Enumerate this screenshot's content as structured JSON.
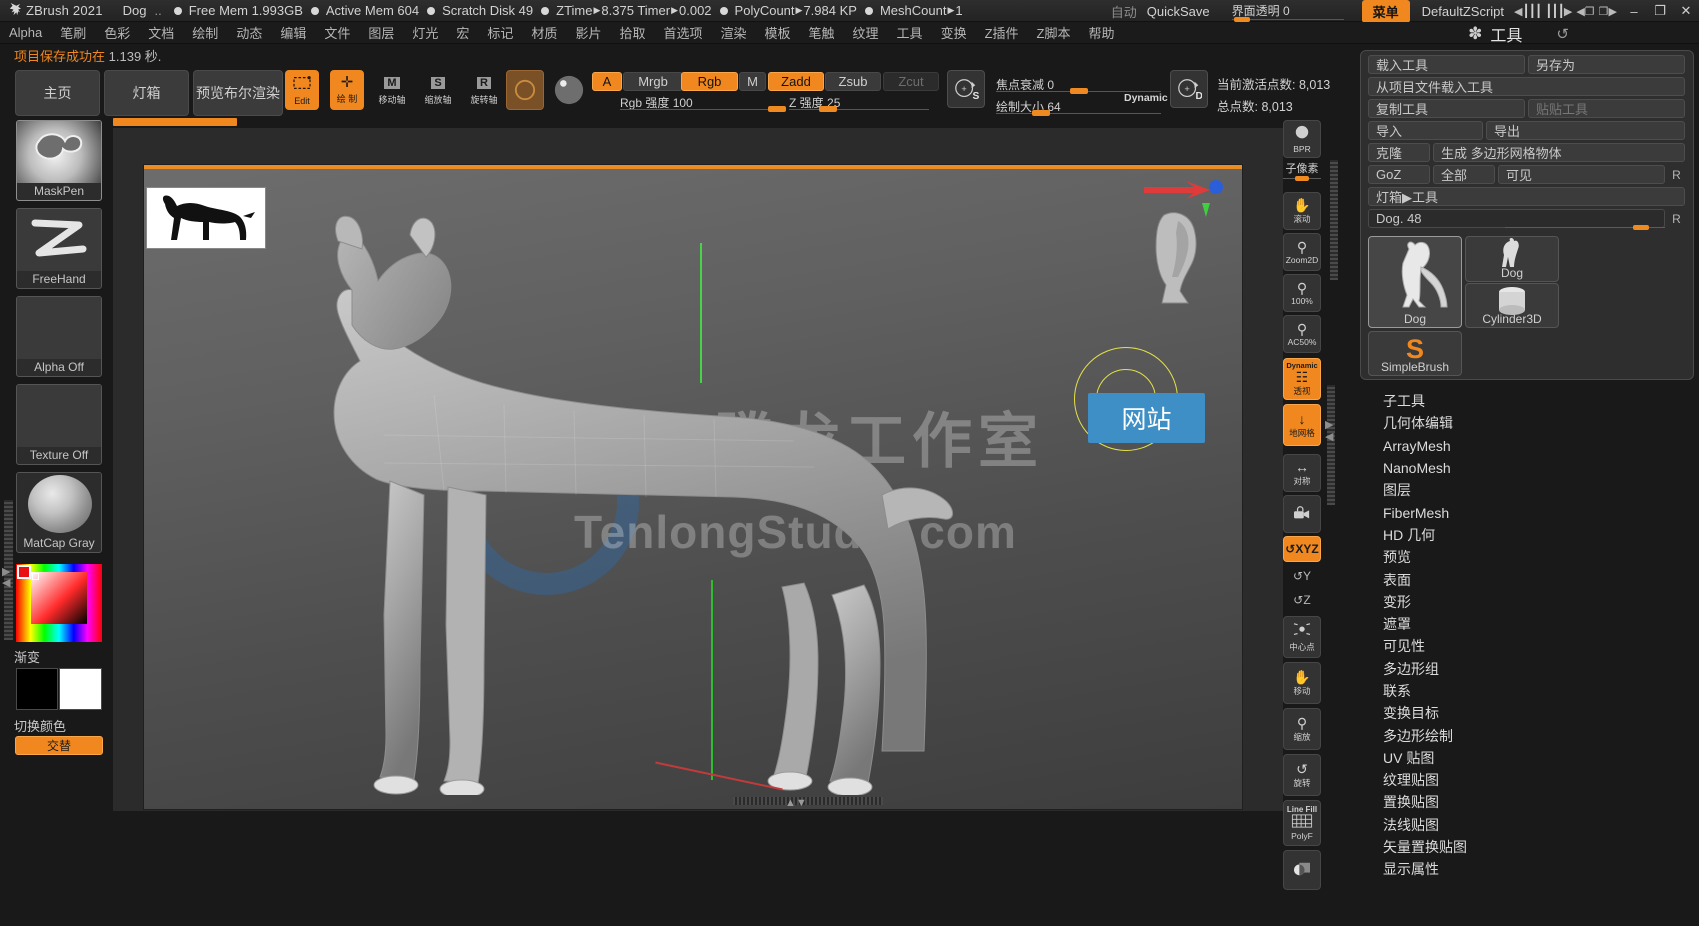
{
  "titlebar": {
    "logo_icon": "zbrush-logo-icon",
    "app_name": "ZBrush 2021",
    "document_name": "Dog",
    "dots": "..",
    "stats": [
      {
        "label": "Free Mem 1.993GB"
      },
      {
        "label": "Active Mem 604"
      },
      {
        "label": "Scratch Disk 49"
      },
      {
        "label": "ZTime",
        "arrow": "▶",
        "value": "8.375 Timer",
        "arrow2": "▶",
        "value2": "0.002"
      },
      {
        "label": "PolyCount",
        "arrow": "▶",
        "value": "7.984 KP"
      },
      {
        "label": "MeshCount",
        "arrow": "▶",
        "value": "1"
      }
    ],
    "auto_label": "自动",
    "quicksave_label": "QuickSave",
    "ui_transparency_label": "界面透明",
    "ui_transparency_value": "0",
    "menu_button": "菜单",
    "zscript_label": "DefaultZScript",
    "minimize": "–",
    "maximize": "❐",
    "close": "✕"
  },
  "menubar": {
    "items": [
      "Alpha",
      "笔刷",
      "色彩",
      "文档",
      "绘制",
      "动态",
      "编辑",
      "文件",
      "图层",
      "灯光",
      "宏",
      "标记",
      "材质",
      "影片",
      "拾取",
      "首选项",
      "渲染",
      "模板",
      "笔触",
      "纹理",
      "工具",
      "变换",
      "Z插件",
      "Z脚本",
      "帮助"
    ],
    "tool_title_icon": "brush-icon",
    "tool_title": "工具",
    "refresh_icon": "↺"
  },
  "status": {
    "message_orange": "项目保存成功在",
    "message_gray": "1.139 秒."
  },
  "toolbar": {
    "home_button": "主页",
    "lightbox_button": "灯箱",
    "preview_bool_render_button": "预览布尔渲染",
    "edit_button": "Edit",
    "draw_button": "绘 制",
    "move_button": "移动轴",
    "scale_button": "缩放轴",
    "rotate_button": "旋转轴",
    "move_badge": "M",
    "scale_badge": "S",
    "rotate_badge": "R",
    "material_icon": "material-sphere-icon",
    "chips": [
      {
        "name": "A",
        "label": "A",
        "state": "on"
      },
      {
        "name": "Mrgb",
        "label": "Mrgb",
        "state": "off"
      },
      {
        "name": "Rgb",
        "label": "Rgb",
        "state": "on"
      },
      {
        "name": "M",
        "label": "M",
        "state": "off"
      },
      {
        "name": "Zadd",
        "label": "Zadd",
        "state": "on"
      },
      {
        "name": "Zsub",
        "label": "Zsub",
        "state": "off"
      },
      {
        "name": "Zcut",
        "label": "Zcut",
        "state": "dim"
      }
    ],
    "rgb_intensity_label": "Rgb 强度",
    "rgb_intensity_value": "100",
    "z_intensity_label": "Z 强度",
    "z_intensity_value": "25",
    "focal_shift_label": "焦点衰减",
    "focal_shift_value": "0",
    "draw_size_label": "绘制大小",
    "draw_size_value": "64",
    "dynamic_label": "Dynamic",
    "s_button_icon": "stroke-s-icon",
    "d_button_icon": "dynamic-d-icon",
    "active_points_label": "当前激活点数: 8,013",
    "total_points_label": "总点数: 8,013"
  },
  "leftbar": {
    "swatches": [
      {
        "name": "maskpen",
        "label": "MaskPen",
        "selected": true
      },
      {
        "name": "freehand",
        "label": "FreeHand",
        "selected": false
      },
      {
        "name": "alpha",
        "label": "Alpha Off",
        "selected": false
      },
      {
        "name": "texture",
        "label": "Texture Off",
        "selected": false
      },
      {
        "name": "matcap",
        "label": "MatCap Gray",
        "selected": false
      }
    ],
    "gradient_label": "渐变",
    "switch_color_label": "切换颜色",
    "alternate_label": "交替"
  },
  "canvas": {
    "reference_image": "dog-silhouette-thumbnail",
    "model": "dog-3d-model",
    "web_badge": "网站",
    "watermark_cn": "腾龙工作室",
    "watermark_en": "TenlongStudio.com"
  },
  "righttools": [
    {
      "name": "bpr",
      "label": "BPR",
      "glyph": "◐",
      "state": "off"
    },
    {
      "name": "subpixel-slider",
      "label": "子像素",
      "type": "slider"
    },
    {
      "name": "scroll",
      "label": "滚动",
      "glyph": "✋",
      "state": "off"
    },
    {
      "name": "zoom2d",
      "label": "Zoom2D",
      "glyph": "⚲",
      "state": "off"
    },
    {
      "name": "actual-size",
      "label": "100%",
      "glyph": "⚲",
      "state": "off"
    },
    {
      "name": "ac50",
      "label": "AC50%",
      "glyph": "⚲",
      "state": "off"
    },
    {
      "name": "perspective",
      "label": "透视",
      "sublabel": "Dynamic",
      "glyph": "☷",
      "state": "on"
    },
    {
      "name": "floor-grid",
      "label": "地网格",
      "glyph": "↓",
      "state": "on"
    },
    {
      "name": "symmetry",
      "label": "对称",
      "glyph": "↔",
      "state": "off"
    },
    {
      "name": "local-lock",
      "label": "",
      "glyph": "🔒",
      "state": "off"
    },
    {
      "name": "xyz",
      "label": "XYZ",
      "glyph": "↺",
      "state": "on"
    },
    {
      "name": "y-axis",
      "label": "Y",
      "glyph": "↺",
      "state": "plain"
    },
    {
      "name": "z-axis",
      "label": "Z",
      "glyph": "↺",
      "state": "plain"
    },
    {
      "name": "center-point",
      "label": "中心点",
      "glyph": "⬚",
      "state": "off"
    },
    {
      "name": "move",
      "label": "移动",
      "glyph": "✋",
      "state": "off"
    },
    {
      "name": "zoom",
      "label": "缩放",
      "glyph": "⚲",
      "state": "off"
    },
    {
      "name": "rotate",
      "label": "旋转",
      "glyph": "↺",
      "state": "off"
    },
    {
      "name": "polyframe",
      "label": "PolyF",
      "sublabel": "Line Fill",
      "glyph": "▒",
      "state": "off"
    },
    {
      "name": "transparency",
      "label": "",
      "glyph": "◑",
      "state": "off"
    }
  ],
  "rightpanel": {
    "buttons": {
      "load_tool": "载入工具",
      "save_as": "另存为",
      "load_from_project": "从项目文件载入工具",
      "copy_tool": "复制工具",
      "paste_tool": "贴贴工具",
      "import": "导入",
      "export": "导出",
      "clone": "克隆",
      "make_polymesh": "生成 多边形网格物体",
      "goz": "GoZ",
      "all": "全部",
      "visible": "可见",
      "r1": "R",
      "r2": "R",
      "lightbox_tool": "灯箱▶工具",
      "tool_name_field": "Dog. 48"
    },
    "tool_slots": [
      {
        "name": "dog-tool",
        "label": "Dog",
        "selected": true
      },
      {
        "name": "dog-tool-2",
        "label": "Dog",
        "selected": false
      },
      {
        "name": "cylinder3d-tool",
        "label": "Cylinder3D",
        "selected": false
      },
      {
        "name": "simplebrush-tool",
        "label": "SimpleBrush",
        "selected": false
      }
    ],
    "subpalettes": [
      "子工具",
      "几何体编辑",
      "ArrayMesh",
      "NanoMesh",
      "图层",
      "FiberMesh",
      "HD 几何",
      "预览",
      "表面",
      "变形",
      "遮罩",
      "可见性",
      "多边形组",
      "联系",
      "变换目标",
      "多边形绘制",
      "UV 贴图",
      "纹理贴图",
      "置换贴图",
      "法线贴图",
      "矢量置换贴图",
      "显示属性"
    ]
  },
  "colors": {
    "accent": "#f0881f",
    "panel_bg": "#2e2e2e",
    "app_bg": "#191919",
    "text": "#c8c8c8",
    "badge_blue": "#3e8fc6"
  }
}
